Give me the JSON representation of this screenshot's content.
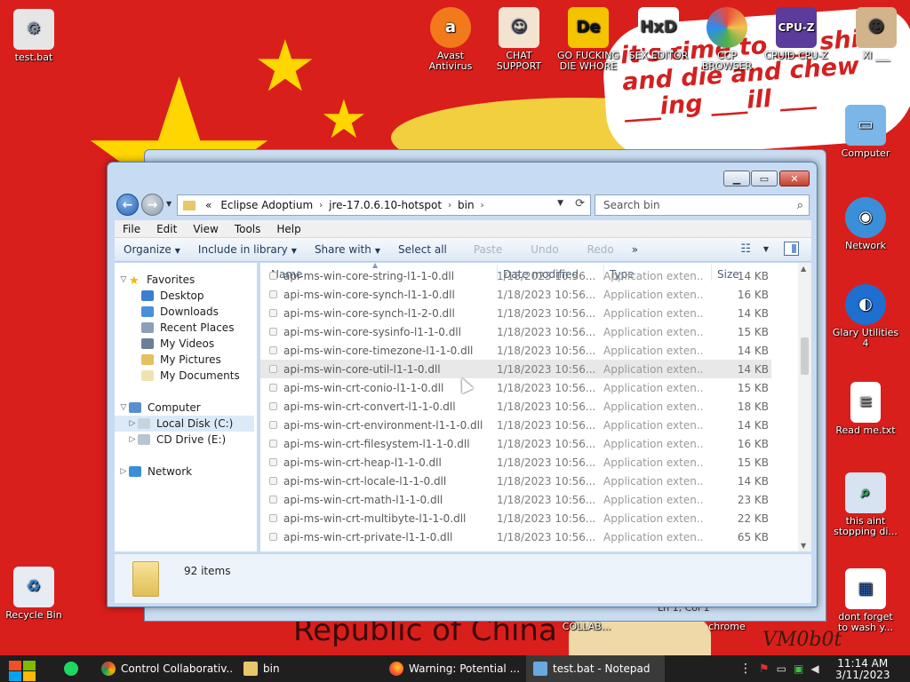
{
  "desktop": {
    "banner_text": "it's time to ___ shit and die and chew ___ing ___ill ___",
    "republic_text": "Republic of China",
    "icons": [
      {
        "label": "test.bat"
      },
      {
        "label": "Avast Antivirus"
      },
      {
        "label": "CHAT SUPPORT"
      },
      {
        "label": "GO FUCKING DIE WHORE"
      },
      {
        "label": "SEX EDITOR"
      },
      {
        "label": "CCP BROWSER"
      },
      {
        "label": "CPUID CPU-Z"
      },
      {
        "label": "XI ___"
      },
      {
        "label": "Computer"
      },
      {
        "label": "Network"
      },
      {
        "label": "Glary Utilities 4"
      },
      {
        "label": "Read me.txt"
      },
      {
        "label": "this aint stopping di..."
      },
      {
        "label": "dont forget to wash y..."
      },
      {
        "label": "Recycle Bin"
      },
      {
        "label": "COLLAB..."
      },
      {
        "label": "chrome"
      }
    ],
    "watermark": "VM0b0t"
  },
  "notepad_bg": {
    "status": "Ln 1, Col 1"
  },
  "explorer": {
    "address": {
      "prefix": "«",
      "crumbs": [
        "Eclipse Adoptium",
        "jre-17.0.6.10-hotspot",
        "bin"
      ]
    },
    "search": {
      "placeholder": "Search bin"
    },
    "menu": [
      "File",
      "Edit",
      "View",
      "Tools",
      "Help"
    ],
    "toolbar": {
      "organize": "Organize",
      "include": "Include in library",
      "share": "Share with",
      "select_all": "Select all",
      "paste": "Paste",
      "undo": "Undo",
      "redo": "Redo",
      "more": "»"
    },
    "nav": {
      "favorites": "Favorites",
      "desktop": "Desktop",
      "downloads": "Downloads",
      "recent": "Recent Places",
      "videos": "My Videos",
      "pictures": "My Pictures",
      "documents": "My Documents",
      "computer": "Computer",
      "local_disk": "Local Disk (C:)",
      "cd_drive": "CD Drive (E:)",
      "network": "Network"
    },
    "columns": {
      "name": "Name",
      "date": "Date modified",
      "type": "Type",
      "size": "Size"
    },
    "files": [
      {
        "name": "api-ms-win-core-string-l1-1-0.dll",
        "date": "1/18/2023 10:56...",
        "type": "Application exten...",
        "size": "14 KB"
      },
      {
        "name": "api-ms-win-core-synch-l1-1-0.dll",
        "date": "1/18/2023 10:56...",
        "type": "Application exten...",
        "size": "16 KB"
      },
      {
        "name": "api-ms-win-core-synch-l1-2-0.dll",
        "date": "1/18/2023 10:56...",
        "type": "Application exten...",
        "size": "14 KB"
      },
      {
        "name": "api-ms-win-core-sysinfo-l1-1-0.dll",
        "date": "1/18/2023 10:56...",
        "type": "Application exten...",
        "size": "15 KB"
      },
      {
        "name": "api-ms-win-core-timezone-l1-1-0.dll",
        "date": "1/18/2023 10:56...",
        "type": "Application exten...",
        "size": "14 KB"
      },
      {
        "name": "api-ms-win-core-util-l1-1-0.dll",
        "date": "1/18/2023 10:56...",
        "type": "Application exten...",
        "size": "14 KB"
      },
      {
        "name": "api-ms-win-crt-conio-l1-1-0.dll",
        "date": "1/18/2023 10:56...",
        "type": "Application exten...",
        "size": "15 KB"
      },
      {
        "name": "api-ms-win-crt-convert-l1-1-0.dll",
        "date": "1/18/2023 10:56...",
        "type": "Application exten...",
        "size": "18 KB"
      },
      {
        "name": "api-ms-win-crt-environment-l1-1-0.dll",
        "date": "1/18/2023 10:56...",
        "type": "Application exten...",
        "size": "14 KB"
      },
      {
        "name": "api-ms-win-crt-filesystem-l1-1-0.dll",
        "date": "1/18/2023 10:56...",
        "type": "Application exten...",
        "size": "16 KB"
      },
      {
        "name": "api-ms-win-crt-heap-l1-1-0.dll",
        "date": "1/18/2023 10:56...",
        "type": "Application exten...",
        "size": "15 KB"
      },
      {
        "name": "api-ms-win-crt-locale-l1-1-0.dll",
        "date": "1/18/2023 10:56...",
        "type": "Application exten...",
        "size": "14 KB"
      },
      {
        "name": "api-ms-win-crt-math-l1-1-0.dll",
        "date": "1/18/2023 10:56...",
        "type": "Application exten...",
        "size": "23 KB"
      },
      {
        "name": "api-ms-win-crt-multibyte-l1-1-0.dll",
        "date": "1/18/2023 10:56...",
        "type": "Application exten...",
        "size": "22 KB"
      },
      {
        "name": "api-ms-win-crt-private-l1-1-0.dll",
        "date": "1/18/2023 10:56...",
        "type": "Application exten...",
        "size": "65 KB"
      }
    ],
    "status": {
      "count": "92 items"
    }
  },
  "taskbar": {
    "tasks": [
      {
        "label": "Control Collaborativ...",
        "icon": "chrome-icon"
      },
      {
        "label": "bin",
        "icon": "folder-icon"
      },
      {
        "label": "Warning: Potential ...",
        "icon": "firefox-icon"
      },
      {
        "label": "test.bat - Notepad",
        "icon": "notepad-icon"
      }
    ],
    "clock": {
      "time": "11:14 AM",
      "date": "3/11/2023"
    }
  },
  "colors": {
    "desktop_red": "#d91f1c",
    "star_yellow": "#ffd600",
    "window_frame": "#c7dbf2",
    "selection": "#dceaf8",
    "taskbar": "#1f1f1f"
  }
}
